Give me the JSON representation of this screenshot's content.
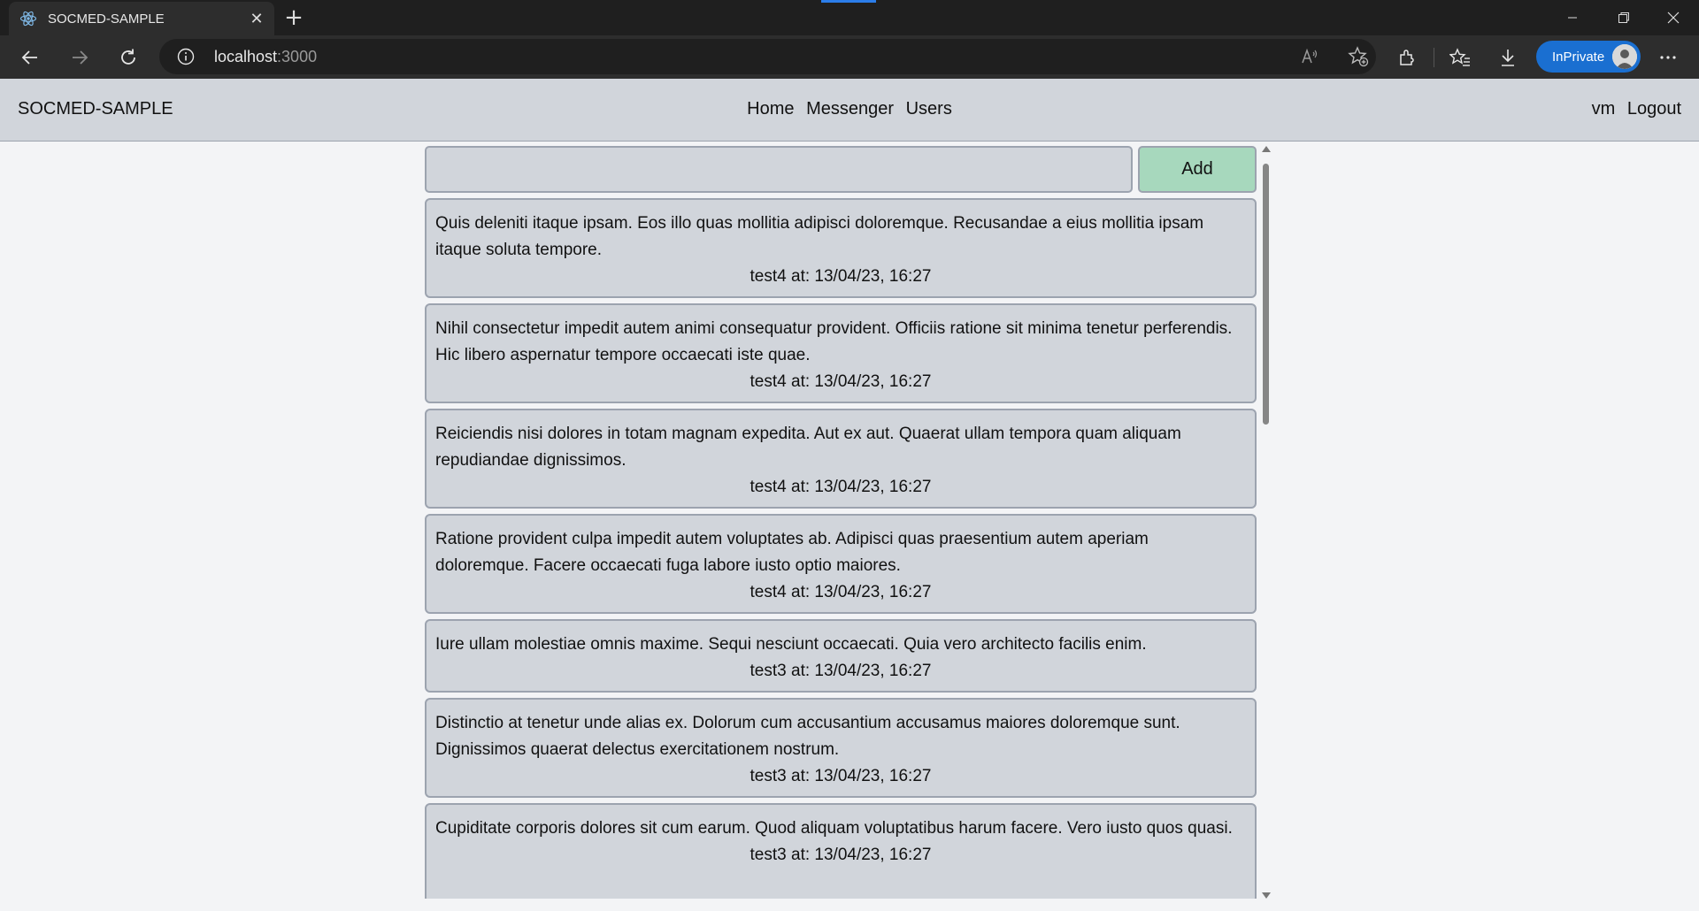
{
  "browser": {
    "tab_title": "SOCMED-SAMPLE",
    "url_host": "localhost",
    "url_port": ":3000",
    "inprivate_label": "InPrivate"
  },
  "app": {
    "brand": "SOCMED-SAMPLE",
    "nav": [
      "Home",
      "Messenger",
      "Users"
    ],
    "user": "vm",
    "logout": "Logout"
  },
  "composer": {
    "input_value": "",
    "add_label": "Add"
  },
  "posts": [
    {
      "text": "Quis deleniti itaque ipsam. Eos illo quas mollitia adipisci doloremque. Recusandae a eius mollitia ipsam itaque soluta tempore.",
      "meta": "test4 at: 13/04/23, 16:27"
    },
    {
      "text": "Nihil consectetur impedit autem animi consequatur provident. Officiis ratione sit minima tenetur perferendis. Hic libero aspernatur tempore occaecati iste quae.",
      "meta": "test4 at: 13/04/23, 16:27"
    },
    {
      "text": "Reiciendis nisi dolores in totam magnam expedita. Aut ex aut. Quaerat ullam tempora quam aliquam repudiandae dignissimos.",
      "meta": "test4 at: 13/04/23, 16:27"
    },
    {
      "text": "Ratione provident culpa impedit autem voluptates ab. Adipisci quas praesentium autem aperiam doloremque. Facere occaecati fuga labore iusto optio maiores.",
      "meta": "test4 at: 13/04/23, 16:27"
    },
    {
      "text": "Iure ullam molestiae omnis maxime. Sequi nesciunt occaecati. Quia vero architecto facilis enim.",
      "meta": "test3 at: 13/04/23, 16:27"
    },
    {
      "text": "Distinctio at tenetur unde alias ex. Dolorum cum accusantium accusamus maiores doloremque sunt. Dignissimos quaerat delectus exercitationem nostrum.",
      "meta": "test3 at: 13/04/23, 16:27"
    },
    {
      "text": "Cupiditate corporis dolores sit cum earum. Quod aliquam voluptatibus harum facere. Vero iusto quos quasi.",
      "meta": "test3 at: 13/04/23, 16:27"
    }
  ]
}
